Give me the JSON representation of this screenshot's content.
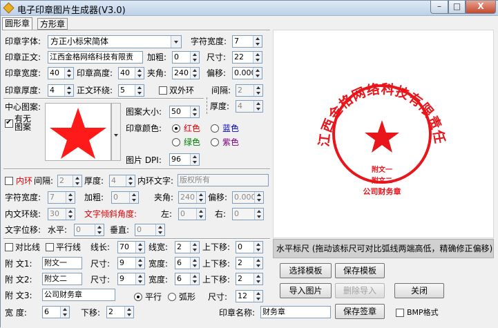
{
  "window": {
    "title": "电子印章图片生成器(V3.0)",
    "min": "–",
    "max": "□",
    "close": "X"
  },
  "tabs": [
    {
      "label": "圆形章",
      "active": true
    },
    {
      "label": "方形章",
      "active": false
    }
  ],
  "form": {
    "font_label": "印章字体:",
    "font_value": "方正小标宋简体",
    "char_width_label": "字符宽度:",
    "char_width": "7",
    "text_label": "印章正文:",
    "text_value": "江西金格网络科技有限责",
    "bold_label": "加粗:",
    "bold": "0",
    "size_label": "尺寸:",
    "size": "22",
    "width_label": "印章宽度:",
    "width": "40",
    "height_label": "印章高度:",
    "height": "40",
    "angle_label": "夹角:",
    "angle": "240",
    "offset_label": "偏移:",
    "offset": "0.000",
    "thickness_label": "印章厚度:",
    "thickness": "4",
    "ring_label": "正文环绕:",
    "ring": "5",
    "double_ring_label": "双外环",
    "gap_label": "间隔:",
    "gap": "2",
    "thick2_label": "厚度:",
    "thick2": "4"
  },
  "center": {
    "label": "中心图案:",
    "has_image_label": "有无图案",
    "size_label": "图案大小:",
    "size": "50",
    "color_label": "印章颜色:",
    "colors": [
      {
        "label": "红色",
        "color": "#e00000",
        "checked": true
      },
      {
        "label": "蓝色",
        "color": "#0000c0",
        "checked": false
      },
      {
        "label": "绿色",
        "color": "#008000",
        "checked": false
      },
      {
        "label": "紫色",
        "color": "#800080",
        "checked": false
      }
    ],
    "dpi_label": "图片 DPI:",
    "dpi": "96"
  },
  "inner": {
    "ring_label": "内环",
    "gap_label": "间隔:",
    "gap": "2",
    "thick_label": "厚度:",
    "thick": "4",
    "text_label": "内环文字:",
    "text_placeholder": "版权所有",
    "char_width_label": "字符宽度:",
    "char_width": "7",
    "bold_label": "加粗:",
    "bold": "0",
    "angle_label": "夹角:",
    "angle": "240",
    "offset_label": "偏移:",
    "offset": "0.000",
    "ring_label2": "内文环绕:",
    "ring": "30",
    "tilt_label": "文字倾斜角度:",
    "left_label": "左:",
    "left": "0",
    "right_label": "右:",
    "right": "0",
    "shift_label": "文字位移:",
    "h_label": "水平:",
    "h": "0",
    "v_label": "垂直:",
    "v": "0"
  },
  "lines": {
    "diag_label": "对比线",
    "para_label": "平行线",
    "len_label": "线长:",
    "len": "70",
    "lw_label": "线宽:",
    "lw": "2",
    "shift_label": "上下移:",
    "shift": "0"
  },
  "subs": [
    {
      "label": "附  文1:",
      "text": "附文一",
      "size_label": "尺寸:",
      "size": "9",
      "w_label": "宽度:",
      "w": "6",
      "s_label": "上下移:",
      "s": "2"
    },
    {
      "label": "附  文2:",
      "text": "附文二",
      "size_label": "尺寸:",
      "size": "9",
      "w_label": "宽度:",
      "w": "6",
      "s_label": "上下移:",
      "s": "2"
    }
  ],
  "sub3": {
    "label": "附  文3:",
    "text": "公司财务章",
    "parallel_label": "平行",
    "arc_label": "弧形",
    "size_label": "尺寸:",
    "size": "12"
  },
  "bottom": {
    "w_label": "宽   度:",
    "w": "6",
    "s_label": "下移:",
    "s": "2",
    "name_label": "印章名称:",
    "name": "财务章"
  },
  "buttons": {
    "select_template": "选择模板",
    "save_template": "保存模板",
    "import_image": "导入图片",
    "delete_import": "删除导入",
    "close": "关闭",
    "save_seal": "保存签章",
    "bmp_label": "BMP格式"
  },
  "ruler_text": "水平标尺 (拖动该标尺可对比弧线两端高低，精确修正偏移)",
  "seal": {
    "ring_text": "江西金格网络科技有限责任公司",
    "sub1": "附文一",
    "sub2": "附文二",
    "sub3": "公司财务章",
    "color": "#e8151b"
  }
}
